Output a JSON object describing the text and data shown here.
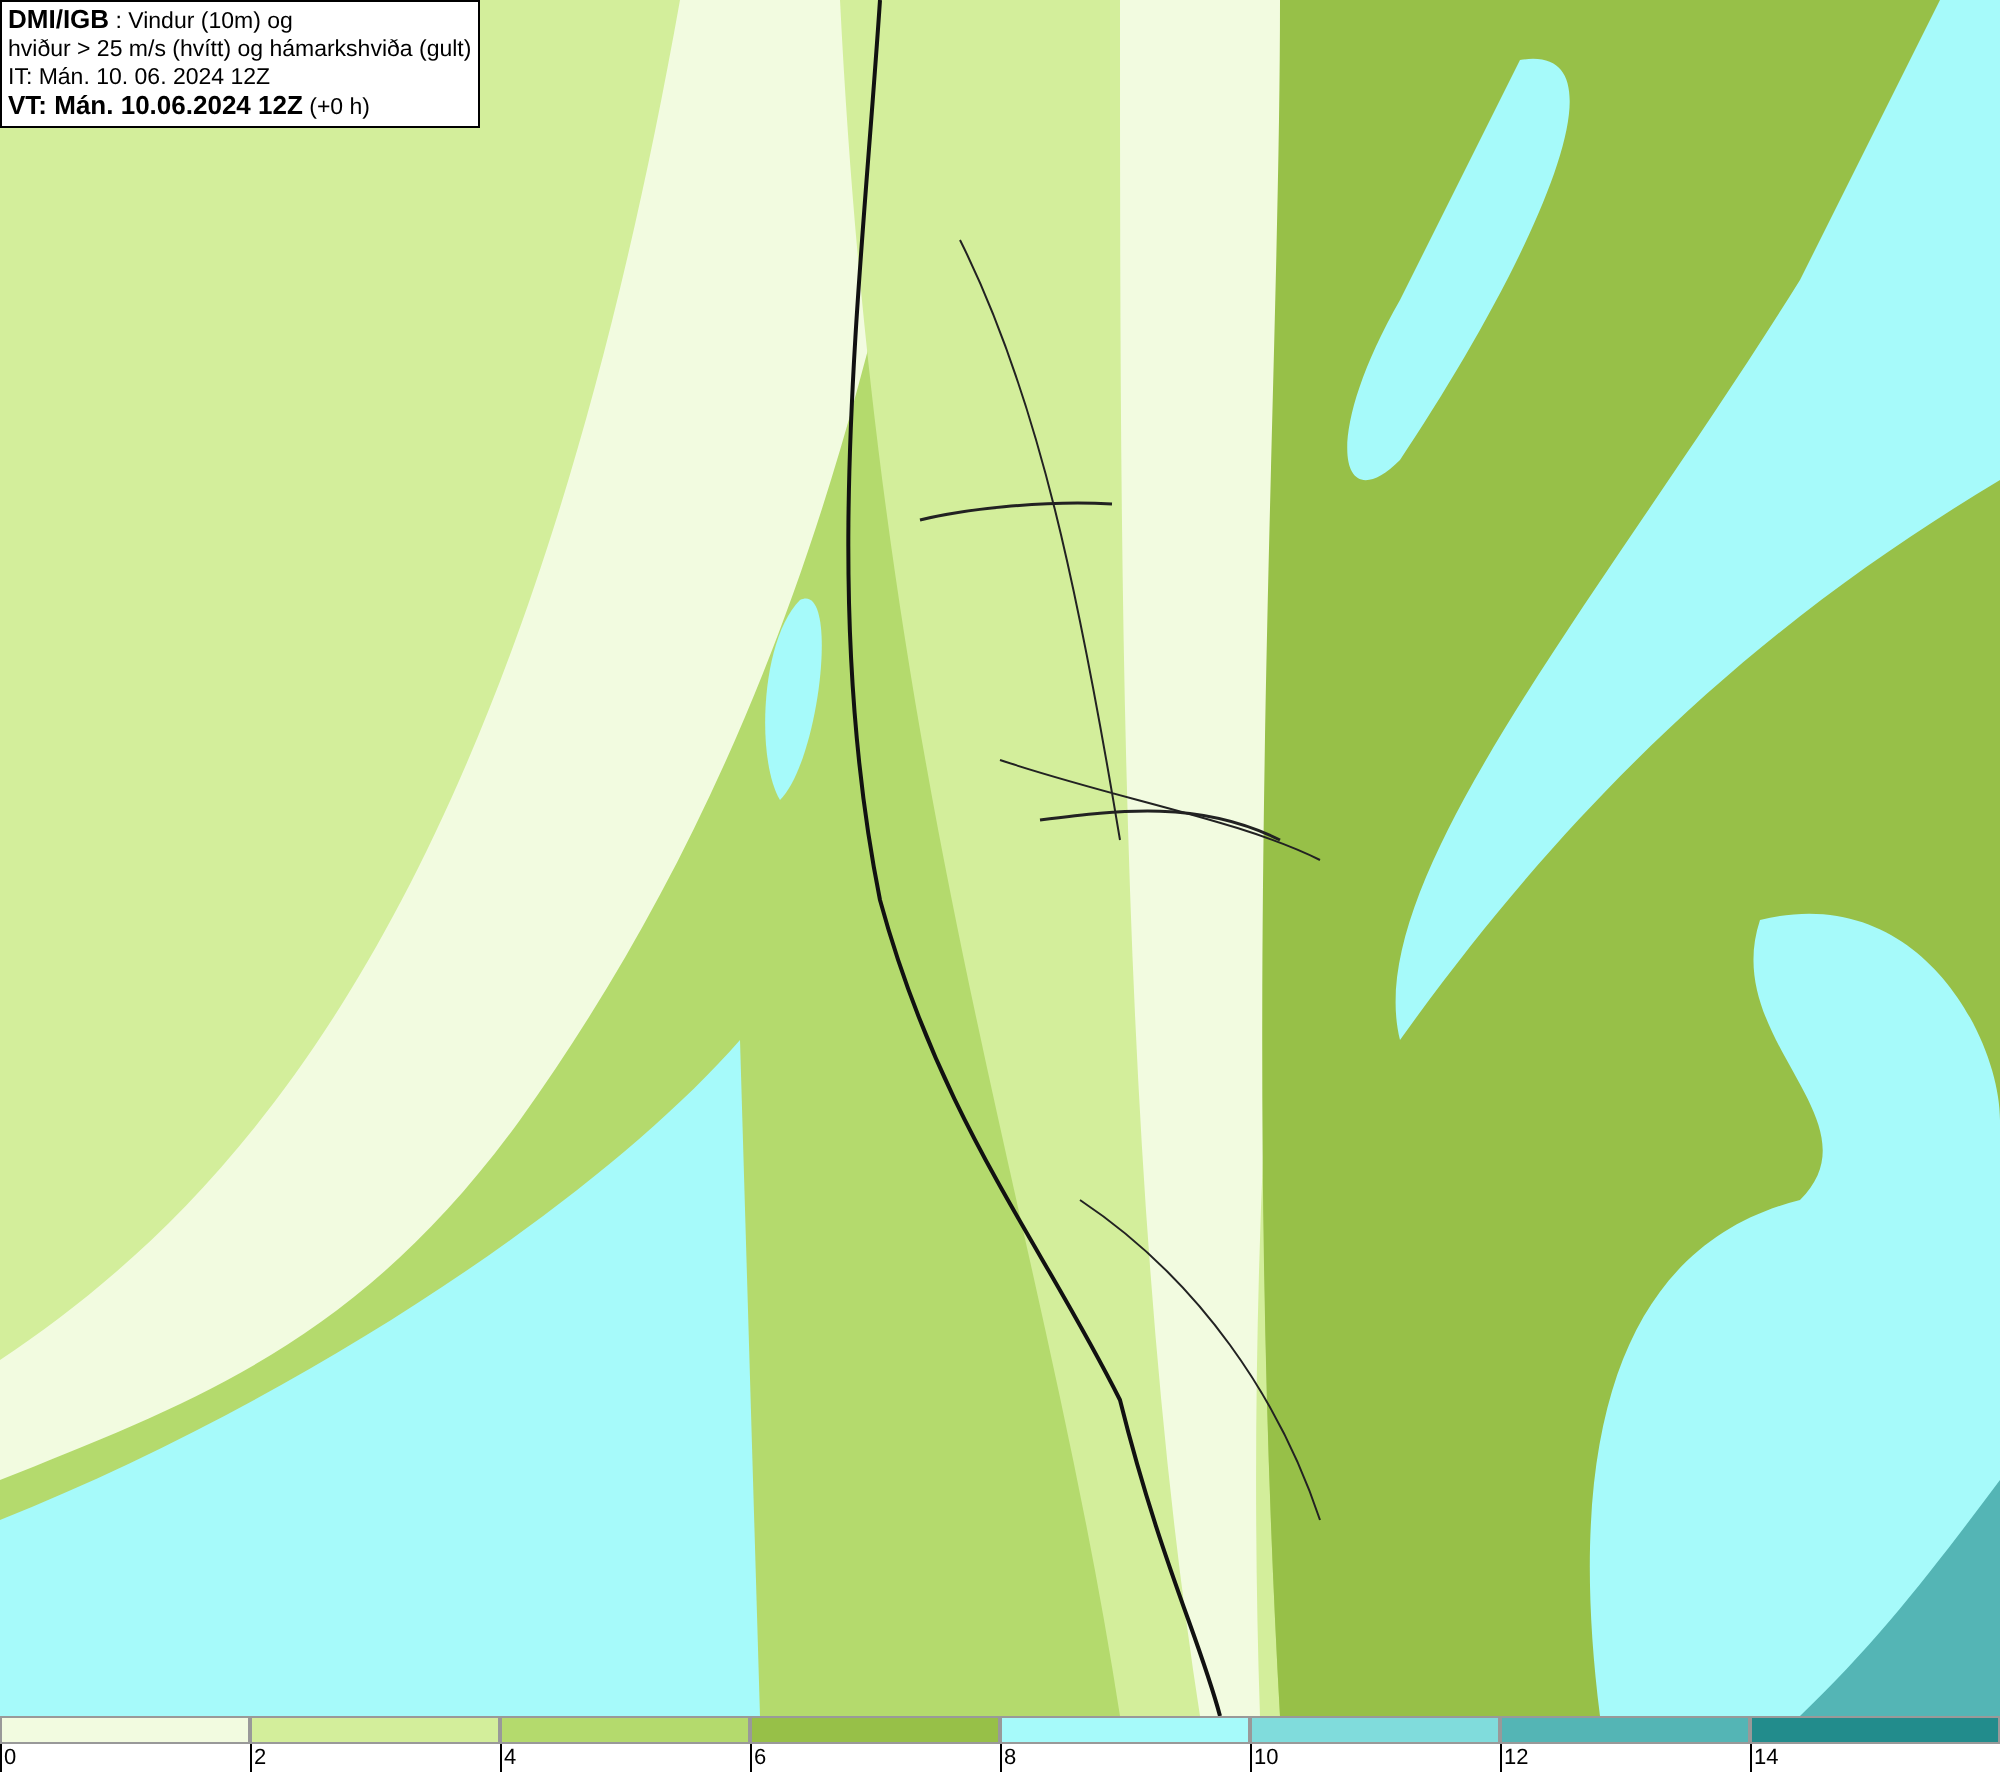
{
  "info_box": {
    "lines": [
      "**DMI/IGB** : Vindur (10m) og",
      "hviður > 25 m/s (hvítt) og hámarkshviða (gult)",
      "IT: Mán. 10. 06. 2024 12Z",
      "**VT: Mán. 10.06.2024 12Z** (+0 h)"
    ]
  },
  "legend": {
    "swatches": [
      {
        "color": "#f2fbe0",
        "label": "0"
      },
      {
        "color": "#d3ee9b",
        "label": "2"
      },
      {
        "color": "#b4da6d",
        "label": "4"
      },
      {
        "color": "#97c048",
        "label": "6"
      },
      {
        "color": "#a6fafa",
        "label": "8"
      },
      {
        "color": "#80dcdc",
        "label": "10"
      },
      {
        "color": "#54b5b5",
        "label": "12"
      },
      {
        "color": "#228c8c",
        "label": "14"
      }
    ]
  }
}
